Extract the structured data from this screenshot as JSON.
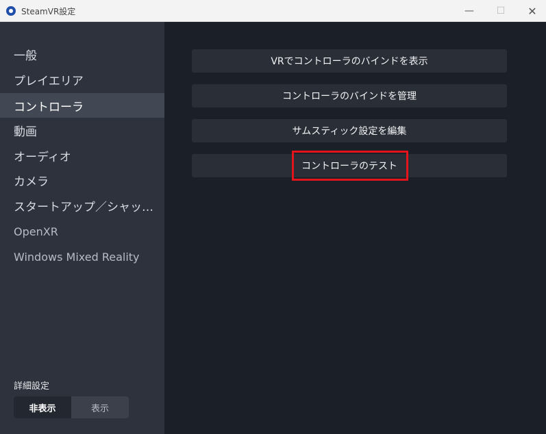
{
  "window": {
    "title": "SteamVR設定",
    "min_glyph": "—",
    "max_glyph": "☐",
    "close_glyph": "✕"
  },
  "sidebar": {
    "items": [
      {
        "label": "一般"
      },
      {
        "label": "プレイエリア"
      },
      {
        "label": "コントローラ",
        "active": true
      },
      {
        "label": "動画"
      },
      {
        "label": "オーディオ"
      },
      {
        "label": "カメラ"
      },
      {
        "label": "スタートアップ／シャッ…"
      },
      {
        "label": "OpenXR"
      },
      {
        "label": "Windows Mixed Reality"
      }
    ],
    "advanced_label": "詳細設定",
    "toggle": {
      "left": "非表示",
      "right": "表示",
      "selected": "非表示"
    }
  },
  "main": {
    "buttons": [
      {
        "label": "VRでコントローラのバインドを表示"
      },
      {
        "label": "コントローラのバインドを管理"
      },
      {
        "label": "サムスティック設定を編集"
      },
      {
        "label": "コントローラのテスト",
        "highlighted": true
      }
    ],
    "highlight_color": "#e3141b"
  },
  "colors": {
    "sidebar_bg": "#2e323c",
    "main_bg": "#1b1f27",
    "button_bg": "#2a2e36",
    "active_item_bg": "#414753"
  }
}
